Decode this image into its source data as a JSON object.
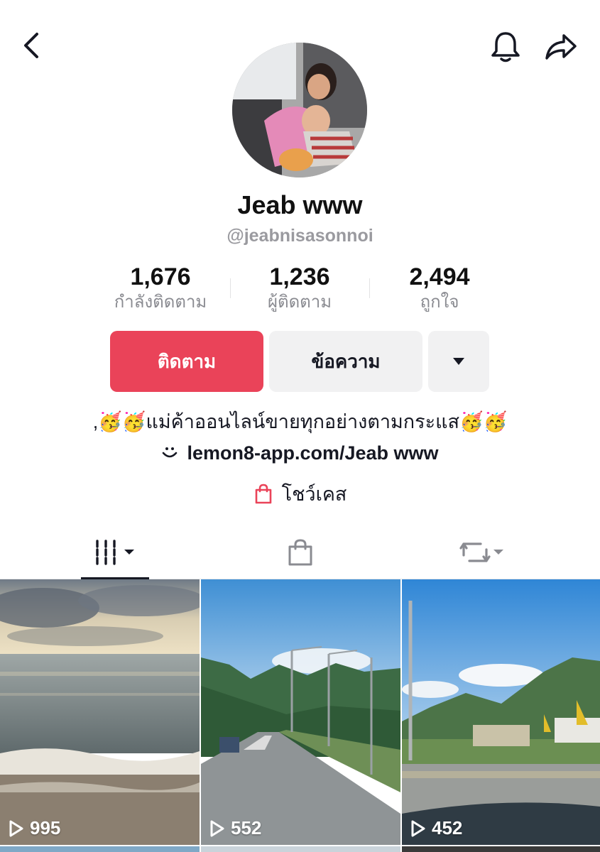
{
  "profile": {
    "display_name": "Jeab www",
    "username": "@jeabnisasonnoi"
  },
  "stats": [
    {
      "value": "1,676",
      "label": "กำลังติดตาม"
    },
    {
      "value": "1,236",
      "label": "ผู้ติดตาม"
    },
    {
      "value": "2,494",
      "label": "ถูกใจ"
    }
  ],
  "actions": {
    "follow_label": "ติดตาม",
    "message_label": "ข้อความ"
  },
  "bio": {
    "text": ",🥳🥳แม่ค้าออนไลน์ขายทุกอย่างตามกระแส🥳🥳",
    "link": "lemon8-app.com/Jeab www"
  },
  "showcase": {
    "label": "โชว์เคส"
  },
  "videos": [
    {
      "views": "995"
    },
    {
      "views": "552"
    },
    {
      "views": "452"
    }
  ],
  "colors": {
    "accent": "#ea4359",
    "secondary_button": "#f1f1f2"
  },
  "icons": {
    "back": "chevron-left-icon",
    "notifications": "bell-icon",
    "share": "share-arrow-icon",
    "more": "caret-down-icon",
    "link": "lemon8-smile-icon",
    "showcase": "shopping-bag-icon",
    "tab_videos": "video-grid-icon",
    "tab_shop": "shopping-bag-icon",
    "tab_repost": "repost-icon",
    "play": "play-icon"
  }
}
